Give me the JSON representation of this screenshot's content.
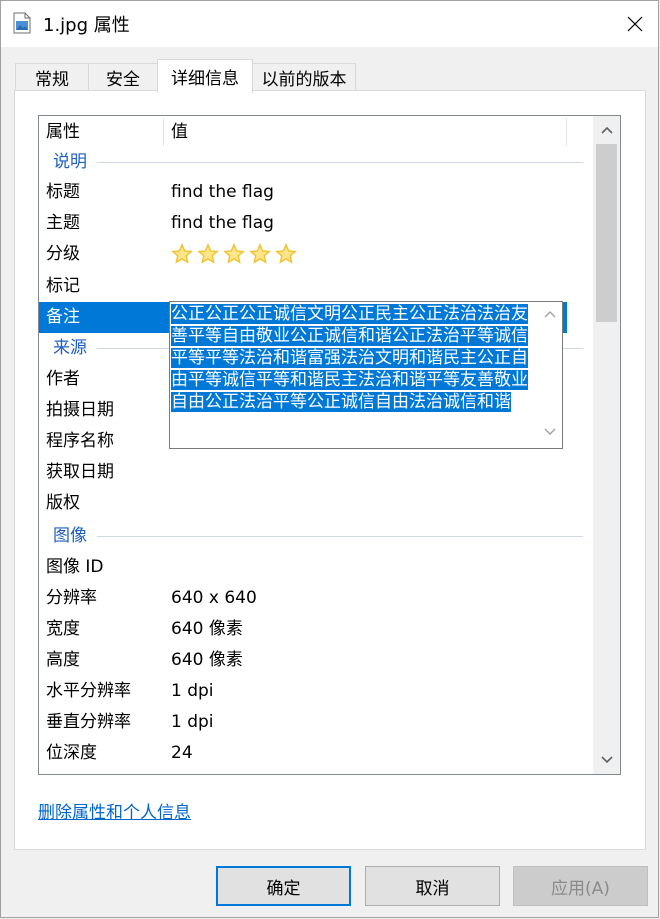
{
  "window": {
    "title": "1.jpg 属性"
  },
  "tabs": [
    "常规",
    "安全",
    "详细信息",
    "以前的版本"
  ],
  "list": {
    "col_property": "属性",
    "col_value": "值",
    "group_desc": "说明",
    "title_label": "标题",
    "title_value": "find the flag",
    "subject_label": "主题",
    "subject_value": "find the flag",
    "rating_label": "分级",
    "rating_value": 5,
    "tags_label": "标记",
    "comments_label": "备注",
    "group_origin": "来源",
    "author_label": "作者",
    "date_taken_label": "拍摄日期",
    "program_label": "程序名称",
    "date_acquired_label": "获取日期",
    "copyright_label": "版权",
    "group_image": "图像",
    "image_id_label": "图像 ID",
    "dimensions_label": "分辨率",
    "dimensions_value": "640 x 640",
    "width_label": "宽度",
    "width_value": "640 像素",
    "height_label": "高度",
    "height_value": "640 像素",
    "hres_label": "水平分辨率",
    "hres_value": "1 dpi",
    "vres_label": "垂直分辨率",
    "vres_value": "1 dpi",
    "bitdepth_label": "位深度",
    "bitdepth_value": "24"
  },
  "comment_text": "公正公正公正诚信文明公正民主公正法治法治友善平等自由敬业公正诚信和谐公正法治平等诚信平等平等法治和谐富强法治文明和谐民主公正自由平等诚信平等和谐民主法治和谐平等友善敬业自由公正法治平等公正诚信自由法治诚信和谐",
  "link_text": "删除属性和个人信息",
  "buttons": {
    "ok": "确定",
    "cancel": "取消",
    "apply": "应用(A)"
  },
  "colors": {
    "accent": "#0078d7",
    "star": "#f2c12e",
    "link": "#0066cc"
  }
}
